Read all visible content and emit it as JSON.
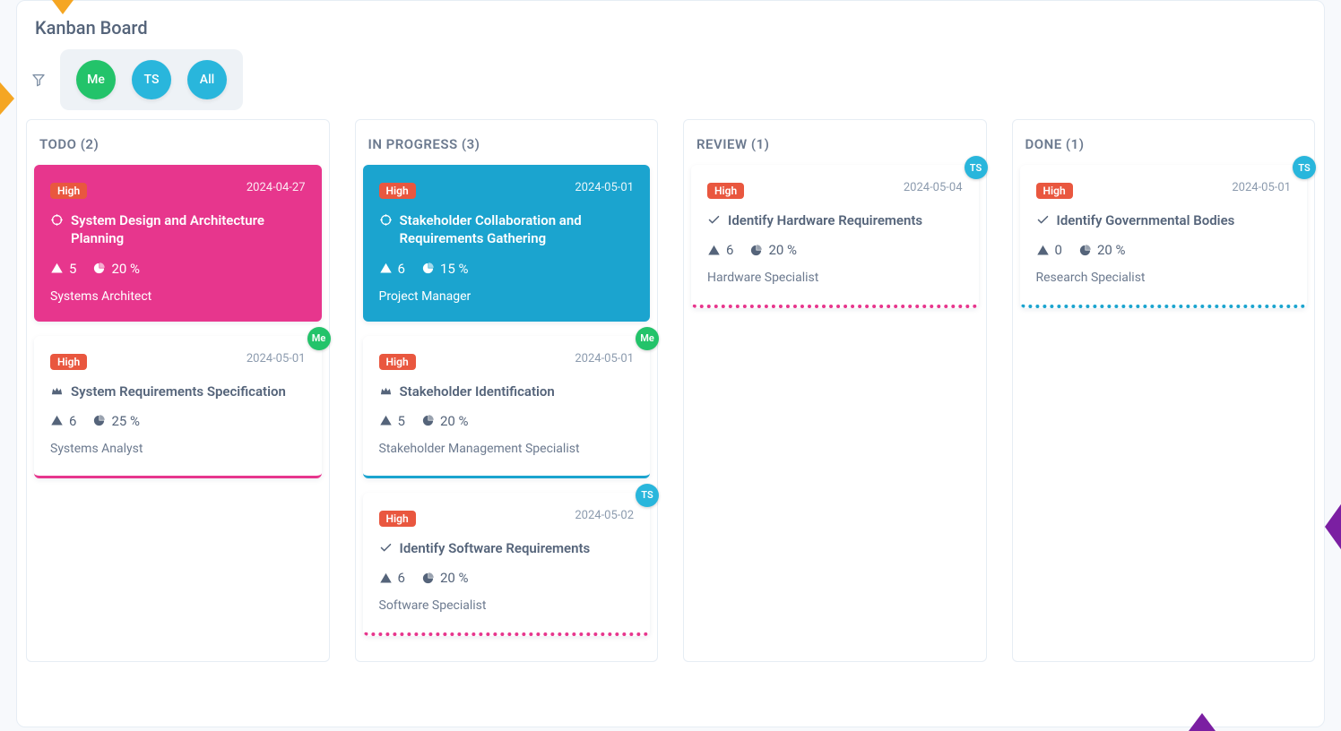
{
  "board_title": "Kanban Board",
  "filters": {
    "me_label": "Me",
    "ts_label": "TS",
    "all_label": "All"
  },
  "columns": [
    {
      "key": "todo",
      "header": "TODO (2)",
      "cards": [
        {
          "priority": "High",
          "date": "2024-04-27",
          "title": "System Design and Architecture Planning",
          "warn": "5",
          "pct": "20 %",
          "role": "Systems Architect",
          "style": "solid-pink",
          "assignee": null,
          "title_icon": "target"
        },
        {
          "priority": "High",
          "date": "2024-05-01",
          "title": "System Requirements Specification",
          "warn": "6",
          "pct": "25 %",
          "role": "Systems Analyst",
          "style": "accent-solid-pink",
          "assignee": "Me",
          "assignee_color": "green",
          "title_icon": "crown"
        }
      ]
    },
    {
      "key": "inprogress",
      "header": "IN PROGRESS (3)",
      "cards": [
        {
          "priority": "High",
          "date": "2024-05-01",
          "title": "Stakeholder Collaboration and Requirements Gathering",
          "warn": "6",
          "pct": "15 %",
          "role": "Project Manager",
          "style": "solid-cyan",
          "assignee": null,
          "title_icon": "target"
        },
        {
          "priority": "High",
          "date": "2024-05-01",
          "title": "Stakeholder Identification",
          "warn": "5",
          "pct": "20 %",
          "role": "Stakeholder Management Specialist",
          "style": "accent-solid-cyan",
          "assignee": "Me",
          "assignee_color": "green",
          "title_icon": "crown"
        },
        {
          "priority": "High",
          "date": "2024-05-02",
          "title": "Identify Software Requirements",
          "warn": "6",
          "pct": "20 %",
          "role": "Software Specialist",
          "style": "accent-dotted-pink",
          "assignee": "TS",
          "assignee_color": "blue",
          "title_icon": "check"
        }
      ]
    },
    {
      "key": "review",
      "header": "REVIEW (1)",
      "cards": [
        {
          "priority": "High",
          "date": "2024-05-04",
          "title": "Identify Hardware Requirements",
          "warn": "6",
          "pct": "20 %",
          "role": "Hardware Specialist",
          "style": "accent-dotted-pink",
          "assignee": "TS",
          "assignee_color": "blue",
          "title_icon": "check"
        }
      ]
    },
    {
      "key": "done",
      "header": "DONE (1)",
      "cards": [
        {
          "priority": "High",
          "date": "2024-05-01",
          "title": "Identify Governmental Bodies",
          "warn": "0",
          "pct": "20 %",
          "role": "Research Specialist",
          "style": "accent-dotted-cyan",
          "assignee": "TS",
          "assignee_color": "blue",
          "title_icon": "check"
        }
      ]
    }
  ]
}
